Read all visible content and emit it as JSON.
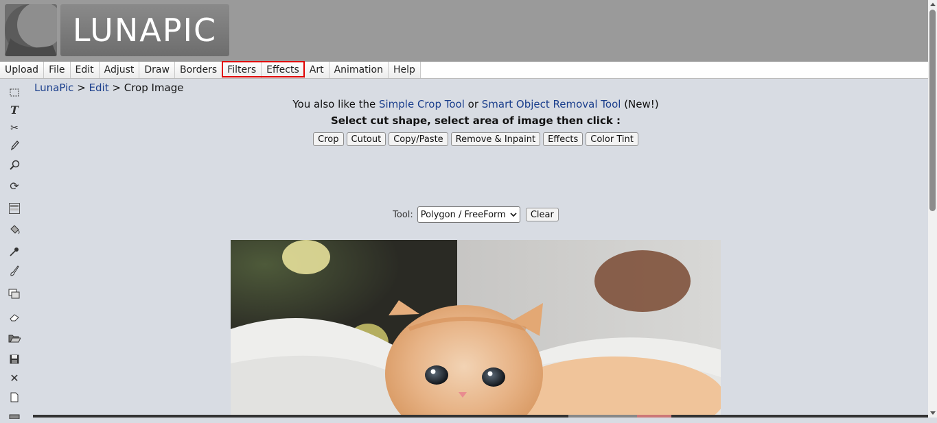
{
  "logo": {
    "text": "LUNAPIC"
  },
  "menu": {
    "items": [
      "Upload",
      "File",
      "Edit",
      "Adjust",
      "Draw",
      "Borders",
      "Filters",
      "Effects",
      "Art",
      "Animation",
      "Help"
    ],
    "highlighted": [
      "Filters",
      "Effects"
    ],
    "highlight_color": "#e00000"
  },
  "toolbox": {
    "icons": [
      "select-rect-icon",
      "text-icon",
      "scissors-icon",
      "pencil-icon",
      "zoom-icon",
      "rotate-icon",
      "gradient-icon",
      "paint-bucket-icon",
      "eyedropper-icon",
      "brush-icon",
      "layers-icon",
      "eraser-icon",
      "open-folder-icon",
      "save-icon",
      "close-icon",
      "new-page-icon",
      "print-icon"
    ]
  },
  "breadcrumb": {
    "home": "LunaPic",
    "sep1": " > ",
    "section": "Edit",
    "sep2": " > ",
    "current": "Crop Image"
  },
  "intro": {
    "prefix": "You also like the ",
    "link1": "Simple Crop Tool",
    "mid": " or ",
    "link2": "Smart Object Removal Tool",
    "suffix": " (New!)"
  },
  "instruction": "Select cut shape, select area of image then click :",
  "actions": [
    "Crop",
    "Cutout",
    "Copy/Paste",
    "Remove & Inpaint",
    "Effects",
    "Color Tint"
  ],
  "tool": {
    "label": "Tool:",
    "selected": "Polygon / FreeForm",
    "clear_label": "Clear"
  },
  "colors": {
    "link": "#1a3e8c",
    "header_bg": "#9a9a9a",
    "page_bg": "#d8dce3"
  }
}
